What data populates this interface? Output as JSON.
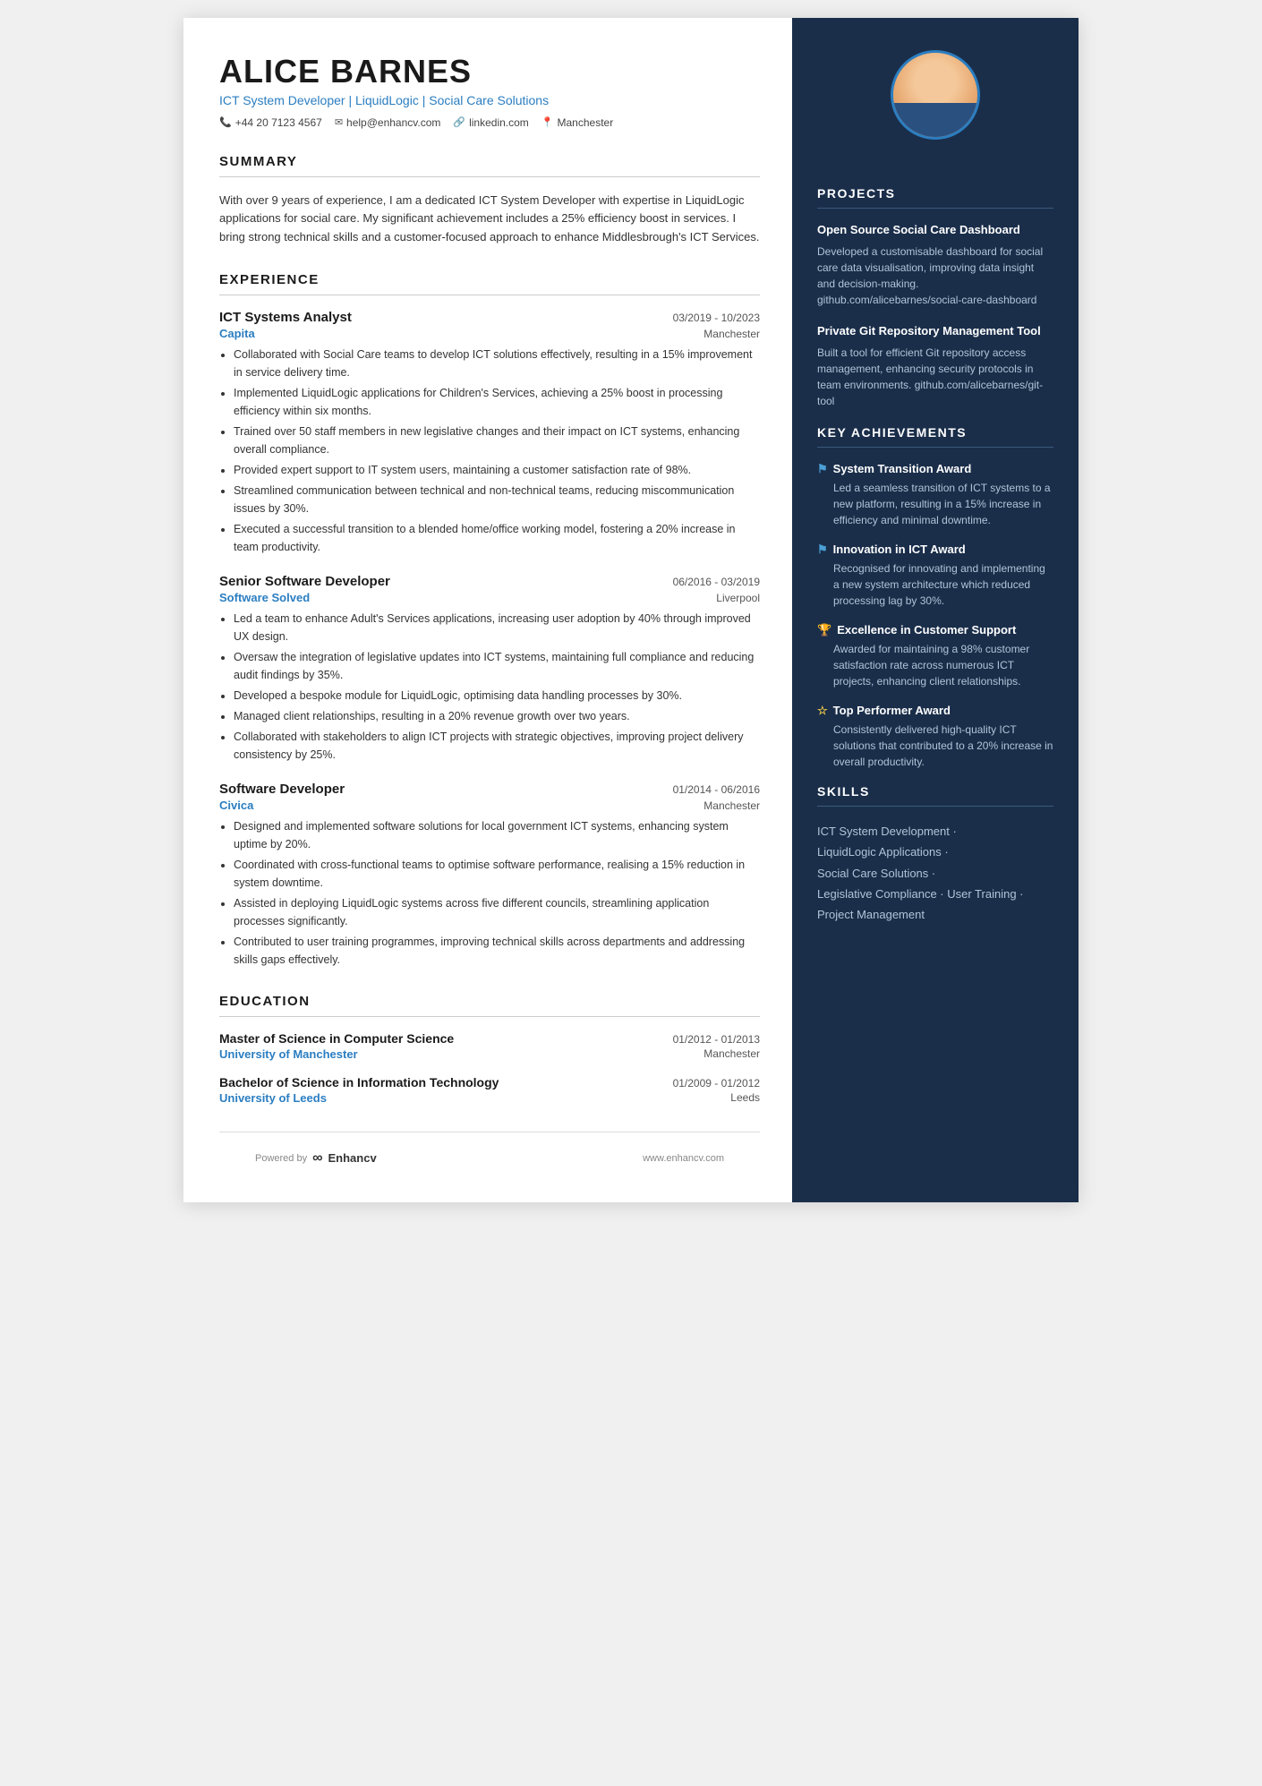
{
  "header": {
    "name": "ALICE BARNES",
    "title": "ICT System Developer | LiquidLogic | Social Care Solutions",
    "contact": [
      {
        "icon": "phone",
        "text": "+44 20 7123 4567"
      },
      {
        "icon": "email",
        "text": "help@enhancv.com"
      },
      {
        "icon": "link",
        "text": "linkedin.com"
      },
      {
        "icon": "location",
        "text": "Manchester"
      }
    ]
  },
  "summary": {
    "label": "SUMMARY",
    "text": "With over 9 years of experience, I am a dedicated ICT System Developer with expertise in LiquidLogic applications for social care. My significant achievement includes a 25% efficiency boost in services. I bring strong technical skills and a customer-focused approach to enhance Middlesbrough's ICT Services."
  },
  "experience": {
    "label": "EXPERIENCE",
    "entries": [
      {
        "title": "ICT Systems Analyst",
        "dates": "03/2019 - 10/2023",
        "company": "Capita",
        "location": "Manchester",
        "bullets": [
          "Collaborated with Social Care teams to develop ICT solutions effectively, resulting in a 15% improvement in service delivery time.",
          "Implemented LiquidLogic applications for Children's Services, achieving a 25% boost in processing efficiency within six months.",
          "Trained over 50 staff members in new legislative changes and their impact on ICT systems, enhancing overall compliance.",
          "Provided expert support to IT system users, maintaining a customer satisfaction rate of 98%.",
          "Streamlined communication between technical and non-technical teams, reducing miscommunication issues by 30%.",
          "Executed a successful transition to a blended home/office working model, fostering a 20% increase in team productivity."
        ]
      },
      {
        "title": "Senior Software Developer",
        "dates": "06/2016 - 03/2019",
        "company": "Software Solved",
        "location": "Liverpool",
        "bullets": [
          "Led a team to enhance Adult's Services applications, increasing user adoption by 40% through improved UX design.",
          "Oversaw the integration of legislative updates into ICT systems, maintaining full compliance and reducing audit findings by 35%.",
          "Developed a bespoke module for LiquidLogic, optimising data handling processes by 30%.",
          "Managed client relationships, resulting in a 20% revenue growth over two years.",
          "Collaborated with stakeholders to align ICT projects with strategic objectives, improving project delivery consistency by 25%."
        ]
      },
      {
        "title": "Software Developer",
        "dates": "01/2014 - 06/2016",
        "company": "Civica",
        "location": "Manchester",
        "bullets": [
          "Designed and implemented software solutions for local government ICT systems, enhancing system uptime by 20%.",
          "Coordinated with cross-functional teams to optimise software performance, realising a 15% reduction in system downtime.",
          "Assisted in deploying LiquidLogic systems across five different councils, streamlining application processes significantly.",
          "Contributed to user training programmes, improving technical skills across departments and addressing skills gaps effectively."
        ]
      }
    ]
  },
  "education": {
    "label": "EDUCATION",
    "entries": [
      {
        "degree": "Master of Science in Computer Science",
        "dates": "01/2012 - 01/2013",
        "school": "University of Manchester",
        "location": "Manchester"
      },
      {
        "degree": "Bachelor of Science in Information Technology",
        "dates": "01/2009 - 01/2012",
        "school": "University of Leeds",
        "location": "Leeds"
      }
    ]
  },
  "footer": {
    "powered_by": "Powered by",
    "logo": "∞",
    "brand": "Enhancv",
    "website": "www.enhancv.com"
  },
  "projects": {
    "label": "PROJECTS",
    "items": [
      {
        "title": "Open Source Social Care Dashboard",
        "description": "Developed a customisable dashboard for social care data visualisation, improving data insight and decision-making. github.com/alicebarnes/social-care-dashboard"
      },
      {
        "title": "Private Git Repository Management Tool",
        "description": "Built a tool for efficient Git repository access management, enhancing security protocols in team environments. github.com/alicebarnes/git-tool"
      }
    ]
  },
  "achievements": {
    "label": "KEY ACHIEVEMENTS",
    "items": [
      {
        "icon": "flag",
        "title": "System Transition Award",
        "description": "Led a seamless transition of ICT systems to a new platform, resulting in a 15% increase in efficiency and minimal downtime."
      },
      {
        "icon": "flag",
        "title": "Innovation in ICT Award",
        "description": "Recognised for innovating and implementing a new system architecture which reduced processing lag by 30%."
      },
      {
        "icon": "trophy",
        "title": "Excellence in Customer Support",
        "description": "Awarded for maintaining a 98% customer satisfaction rate across numerous ICT projects, enhancing client relationships."
      },
      {
        "icon": "star",
        "title": "Top Performer Award",
        "description": "Consistently delivered high-quality ICT solutions that contributed to a 20% increase in overall productivity."
      }
    ]
  },
  "skills": {
    "label": "SKILLS",
    "items": [
      {
        "text": "ICT System Development ·"
      },
      {
        "text": "LiquidLogic Applications ·"
      },
      {
        "text": "Social Care Solutions ·"
      },
      {
        "text": "Legislative Compliance · User Training ·"
      },
      {
        "text": "Project Management"
      }
    ]
  }
}
